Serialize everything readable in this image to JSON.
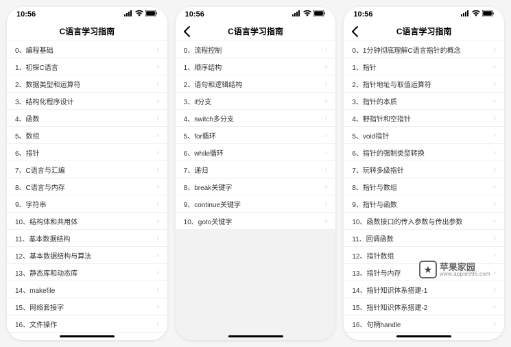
{
  "status": {
    "time": "10:56"
  },
  "screens": [
    {
      "title": "C语言学习指南",
      "showBack": false,
      "items": [
        "0、编程基础",
        "1、初探C语言",
        "2、数据类型和运算符",
        "3、结构化程序设计",
        "4、函数",
        "5、数组",
        "6、指针",
        "7、C语言与汇编",
        "8、C语言与内存",
        "9、字符串",
        "10、结构体和共用体",
        "11、基本数据结构",
        "12、基本数据结构与算法",
        "13、静态库和动态库",
        "14、makefile",
        "15、网络套接字",
        "16、文件操作"
      ]
    },
    {
      "title": "C语言学习指南",
      "showBack": true,
      "items": [
        "0、流程控制",
        "1、顺序结构",
        "2、语句和逻辑结构",
        "3、if分支",
        "4、switch多分支",
        "5、for循环",
        "6、while循环",
        "7、递归",
        "8、break关键字",
        "9、continue关键字",
        "10、goto关键字"
      ]
    },
    {
      "title": "C语言学习指南",
      "showBack": true,
      "items": [
        "0、1分钟彻底理解C语言指针的概念",
        "1、指针",
        "2、指针地址与取值运算符",
        "3、指针的本质",
        "4、野指针和空指针",
        "5、void指针",
        "6、指针的强制类型转换",
        "7、玩转多级指针",
        "8、指针与数组",
        "9、指针与函数",
        "10、函数接口的传入参数与传出参数",
        "11、回调函数",
        "12、指针数组",
        "13、指针与内存",
        "14、指针知识体系搭建-1",
        "15、指针知识体系搭建-2",
        "16、句柄handle"
      ]
    }
  ],
  "watermark": {
    "main": "苹果家园",
    "sub": "www.apple996.com"
  }
}
